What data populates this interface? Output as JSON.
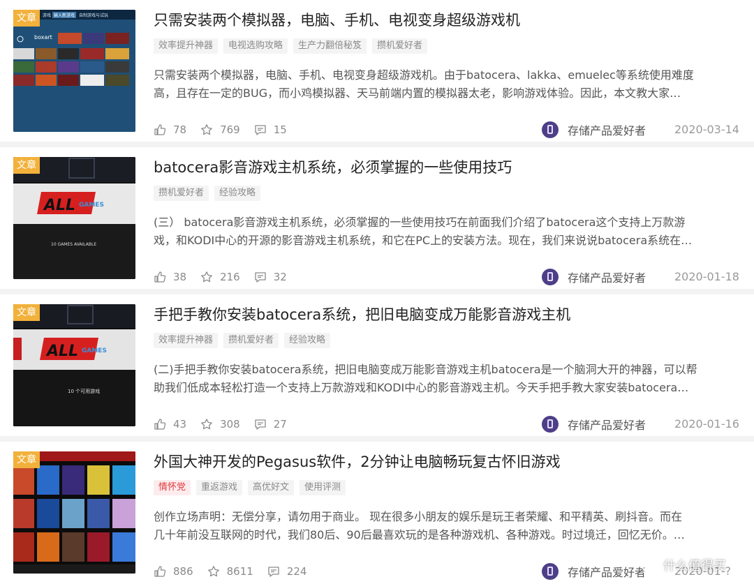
{
  "articles": [
    {
      "badge": "文章",
      "title": "只需安装两个模拟器，电脑、手机、电视变身超级游戏机",
      "tags": [
        {
          "label": "效率提升神器",
          "hot": false
        },
        {
          "label": "电视选购攻略",
          "hot": false
        },
        {
          "label": "生产力翻倍秘笈",
          "hot": false
        },
        {
          "label": "攒机爱好者",
          "hot": false
        }
      ],
      "excerpt_line1": "只需安装两个模拟器，电脑、手机、电视变身超级游戏机。由于batocera、lakka、emuelec等系统使用难度",
      "excerpt_line2": "高，且存在一定的BUG，而小鸡模拟器、天马前端内置的模拟器太老，影响游戏体验。因此，本文教大家…",
      "likes": "78",
      "favorites": "769",
      "comments": "15",
      "author": "存储产品爱好者",
      "date": "2020-03-14",
      "thumb_text": {
        "tab1": "游戏",
        "tab2": "输入新游戏",
        "tab3": "自制游戏与试玩",
        "label": "boxart"
      }
    },
    {
      "badge": "文章",
      "title": "batocera影音游戏主机系统，必须掌握的一些使用技巧",
      "tags": [
        {
          "label": "攒机爱好者",
          "hot": false
        },
        {
          "label": "经验攻略",
          "hot": false
        }
      ],
      "excerpt_line1": "(三） batocera影音游戏主机系统，必须掌握的一些使用技巧在前面我们介绍了batocera这个支持上万款游",
      "excerpt_line2": "戏，和KODI中心的开源的影音游戏主机系统，和它在PC上的安装方法。现在，我们来说说batocera系统在…",
      "likes": "38",
      "favorites": "216",
      "comments": "32",
      "author": "存储产品爱好者",
      "date": "2020-01-18",
      "thumb_text": {
        "logo": "ALL",
        "logo_sub": "GAMES",
        "caption": "10 GAMES AVAILABLE"
      }
    },
    {
      "badge": "文章",
      "title": "手把手教你安装batocera系统，把旧电脑变成万能影音游戏主机",
      "tags": [
        {
          "label": "效率提升神器",
          "hot": false
        },
        {
          "label": "攒机爱好者",
          "hot": false
        },
        {
          "label": "经验攻略",
          "hot": false
        }
      ],
      "excerpt_line1": "(二)手把手教你安装batocera系统，把旧电脑变成万能影音游戏主机batocera是一个脑洞大开的神器，可以帮",
      "excerpt_line2": "助我们低成本轻松打造一个支持上万款游戏和KODI中心的影音游戏主机。今天手把手教大家安装batocera…",
      "likes": "43",
      "favorites": "308",
      "comments": "27",
      "author": "存储产品爱好者",
      "date": "2020-01-16",
      "thumb_text": {
        "logo": "ALL",
        "logo_sub": "GAMES",
        "caption": "10 个可用游戏"
      }
    },
    {
      "badge": "文章",
      "title": "外国大神开发的Pegasus软件，2分钟让电脑畅玩复古怀旧游戏",
      "tags": [
        {
          "label": "情怀党",
          "hot": true
        },
        {
          "label": "重返游戏",
          "hot": false
        },
        {
          "label": "高优好文",
          "hot": false
        },
        {
          "label": "使用评测",
          "hot": false
        }
      ],
      "excerpt_line1": "创作立场声明：无偿分享，请勿用于商业。 现在很多小朋友的娱乐是玩王者荣耀、和平精英、刷抖音。而在",
      "excerpt_line2": "几十年前没互联网的时代，我们80后、90后最喜欢玩的是各种游戏机、各种游戏。时过境迁，回忆无价。…",
      "likes": "886",
      "favorites": "8611",
      "comments": "224",
      "author": "存储产品爱好者",
      "date": "2020-01-?",
      "thumb_text": {}
    }
  ],
  "watermark": "什么值得买",
  "colors": {
    "badge": "#f2b13b",
    "hot_tag_text": "#e4393c",
    "hot_tag_bg": "#fdecee",
    "tag_bg": "#f4f4f4",
    "avatar": "#4d3f87"
  }
}
